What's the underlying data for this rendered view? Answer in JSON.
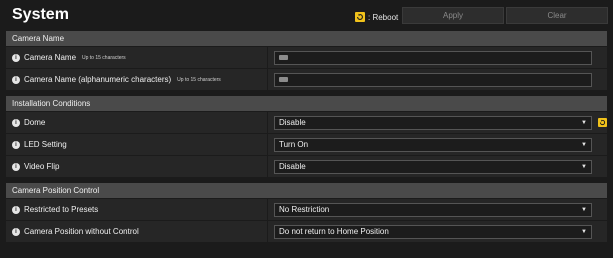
{
  "header": {
    "title": "System",
    "reboot_label": ": Reboot",
    "apply_label": "Apply",
    "clear_label": "Clear"
  },
  "sections": [
    {
      "title": "Camera Name",
      "rows": [
        {
          "label": "Camera Name",
          "sub": "Up to 15 characters",
          "type": "text",
          "value": ""
        },
        {
          "label": "Camera Name (alphanumeric characters)",
          "sub": "Up to 15 characters",
          "type": "text",
          "value": ""
        }
      ]
    },
    {
      "title": "Installation Conditions",
      "rows": [
        {
          "label": "Dome",
          "type": "select",
          "value": "Disable",
          "reboot": true
        },
        {
          "label": "LED Setting",
          "type": "select",
          "value": "Turn On"
        },
        {
          "label": "Video Flip",
          "type": "select",
          "value": "Disable"
        }
      ]
    },
    {
      "title": "Camera Position Control",
      "rows": [
        {
          "label": "Restricted to Presets",
          "type": "select",
          "value": "No Restriction"
        },
        {
          "label": "Camera Position without Control",
          "type": "select",
          "value": "Do not return to Home Position"
        }
      ]
    }
  ],
  "colors": {
    "reboot_accent": "#f1c21b",
    "section_header_bg": "#4a4a4a",
    "row_bg": "#262626"
  },
  "icons": {
    "info": "info-icon",
    "reboot": "reboot-icon",
    "caret": "chevron-down-icon"
  }
}
